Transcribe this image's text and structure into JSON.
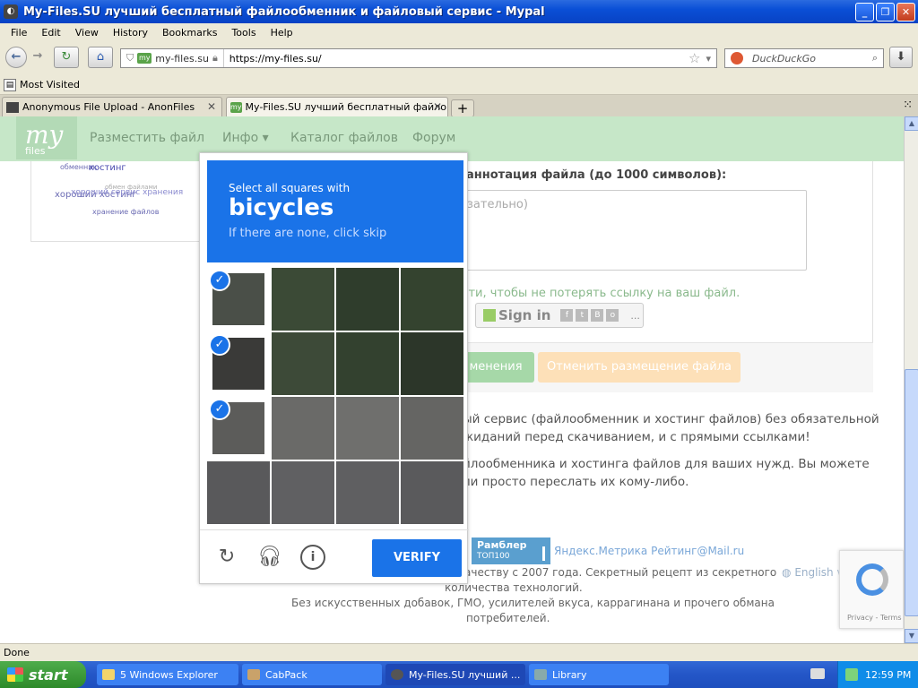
{
  "window": {
    "title": "My-Files.SU лучший бесплатный файлообменник и файловый сервис - Mypal",
    "buttons": {
      "minimize": "_",
      "maximize": "❐",
      "close": "✕"
    }
  },
  "menu": [
    "File",
    "Edit",
    "View",
    "History",
    "Bookmarks",
    "Tools",
    "Help"
  ],
  "nav": {
    "site_identity": "my-files.su",
    "url": "https://my-files.su/",
    "search_placeholder": "DuckDuckGo"
  },
  "bookmarks": {
    "most_visited": "Most Visited"
  },
  "tabs": [
    {
      "label": "Anonymous File Upload - AnonFiles"
    },
    {
      "label": "My-Files.SU лучший бесплатный файло..."
    }
  ],
  "site": {
    "logo": {
      "line1": "my",
      "line2": "files"
    },
    "nav": [
      "Разместить файл",
      "Инфо ▾",
      "Каталог файлов",
      "Форум"
    ],
    "tagcloud": [
      "обменник",
      "хостинг",
      "хороший хостинг",
      "хороший сервис хранения",
      "обмен файлами",
      "хранение файлов"
    ],
    "annotation_label": "аннотация файла (до 1000 символов):",
    "annotation_placeholder": "зательно)",
    "login_hint": "йти, чтобы не потерять ссылку на ваш файл.",
    "signin": "Sign in",
    "signin_more": "...",
    "btn_confirm": "менения",
    "btn_cancel": "Отменить размещение файла",
    "desc1": "ый сервис (файлообменник и хостинг файлов) без обязательной",
    "desc2": "жиданий перед скачиванием, и с прямыми ссылками!",
    "desc3": "йлообменника и хостинга файлов для ваших нужд. Вы можете",
    "desc4": "ли просто переслать их кому-либо.",
    "rambler": {
      "name": "Рамблер",
      "sub": "ТОП100"
    },
    "counters": "Яндекс.Метрика Рейтинг@Mail.ru",
    "footer1": "ачеству с 2007 года. Секретный рецепт из секретного",
    "footer2": "количества технологий.",
    "footer3": "Без искусственных добавок, ГМО, усилителей вкуса, каррагинана и прочего обмана",
    "footer4": "потребителей.",
    "english": "English version",
    "recaptcha": "Privacy - Terms"
  },
  "captcha": {
    "prompt": "Select all squares with",
    "object": "bicycles",
    "hint": "If there are none, click skip",
    "verify": "VERIFY",
    "tiles": [
      {
        "selected": true
      },
      {
        "selected": false
      },
      {
        "selected": false
      },
      {
        "selected": false
      },
      {
        "selected": true
      },
      {
        "selected": false
      },
      {
        "selected": false
      },
      {
        "selected": false
      },
      {
        "selected": true
      },
      {
        "selected": false
      },
      {
        "selected": false
      },
      {
        "selected": false
      },
      {
        "selected": false
      },
      {
        "selected": false
      },
      {
        "selected": false
      },
      {
        "selected": false
      }
    ]
  },
  "status": "Done",
  "taskbar": {
    "start": "start",
    "tasks": [
      "5 Windows Explorer",
      "CabPack",
      "My-Files.SU лучший ...",
      "Library"
    ],
    "clock": "12:59 PM"
  }
}
